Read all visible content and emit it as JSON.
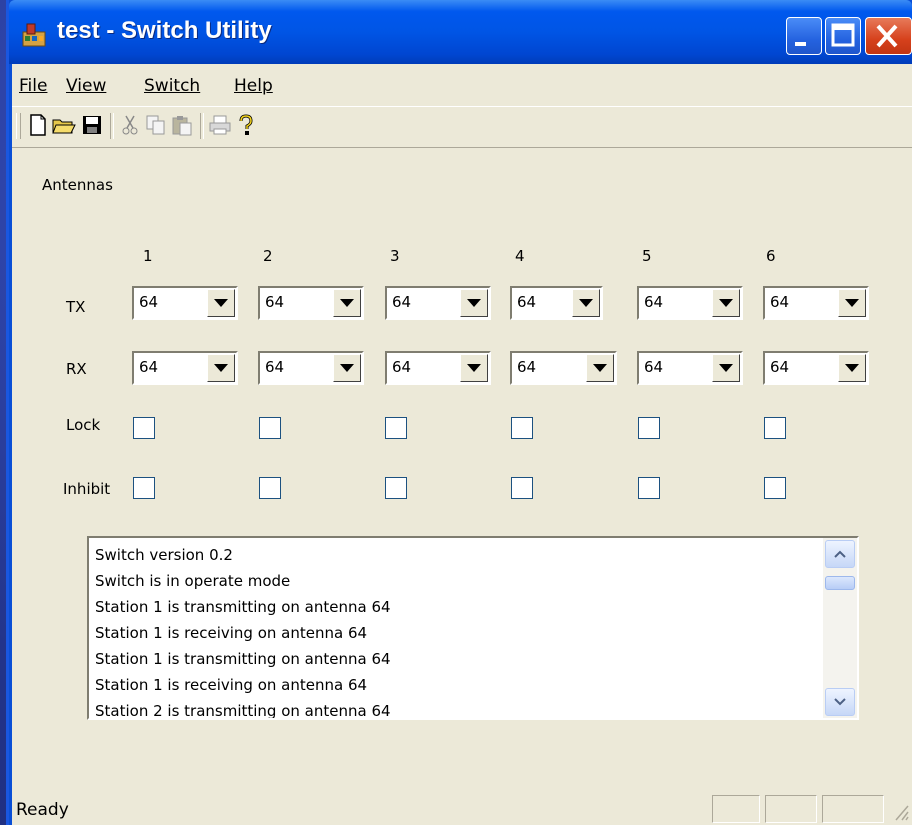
{
  "window": {
    "title": "test - Switch Utility"
  },
  "menu": {
    "file": "File",
    "view": "View",
    "switch": "Switch",
    "help": "Help"
  },
  "toolbar": [
    "new-file-icon",
    "open-folder-icon",
    "save-icon",
    "cut-icon",
    "copy-icon",
    "paste-icon",
    "print-icon",
    "help-icon"
  ],
  "antennas": {
    "group_label": "Antennas",
    "columns": [
      "1",
      "2",
      "3",
      "4",
      "5",
      "6"
    ],
    "tx_label": "TX",
    "rx_label": "RX",
    "lock_label": "Lock",
    "inhibit_label": "Inhibit",
    "tx_values": [
      "64",
      "64",
      "64",
      "64",
      "64",
      "64"
    ],
    "rx_values": [
      "64",
      "64",
      "64",
      "64",
      "64",
      "64"
    ],
    "lock_checked": [
      false,
      false,
      false,
      false,
      false,
      false
    ],
    "inhibit_checked": [
      false,
      false,
      false,
      false,
      false,
      false
    ]
  },
  "log": [
    "Switch version 0.2",
    "Switch is in operate mode",
    "Station 1 is transmitting on antenna 64",
    "Station 1 is receiving on antenna 64",
    "Station 1 is transmitting on antenna 64",
    "Station 1 is receiving on antenna 64",
    "Station 2 is transmitting on antenna 64"
  ],
  "status": {
    "text": "Ready"
  }
}
